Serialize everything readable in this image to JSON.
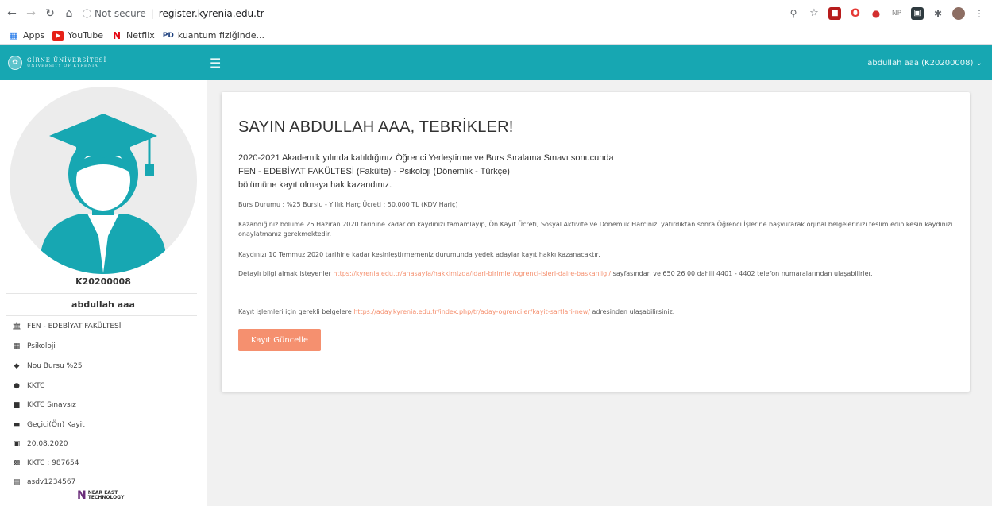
{
  "browser": {
    "security_label": "Not secure",
    "url": "register.kyrenia.edu.tr",
    "bookmarks": [
      {
        "label": "Apps",
        "icon": "apps-grid-icon"
      },
      {
        "label": "YouTube",
        "icon": "youtube-icon"
      },
      {
        "label": "Netflix",
        "icon": "netflix-icon"
      },
      {
        "label": "kuantum fiziğinde...",
        "icon": "pd-icon"
      }
    ],
    "extension_np_label": "NP"
  },
  "header": {
    "brand_line1": "GİRNE ÜNİVERSİTESİ",
    "brand_line2": "UNIVERSITY OF KYRENIA",
    "user_menu": "abdullah aaa (K20200008)",
    "accent_color": "#17a7b2"
  },
  "sidebar": {
    "student_id": "K20200008",
    "student_name": "abdullah aaa",
    "items": [
      {
        "icon": "bank-icon",
        "label": "FEN - EDEBİYAT FAKÜLTESİ"
      },
      {
        "icon": "building-icon",
        "label": "Psikoloji"
      },
      {
        "icon": "tag-icon",
        "label": "Nou Bursu %25"
      },
      {
        "icon": "map-marker-icon",
        "label": "KKTC"
      },
      {
        "icon": "user-tie-icon",
        "label": "KKTC Sınavsız"
      },
      {
        "icon": "car-icon",
        "label": "Geçici(Ön) Kayit"
      },
      {
        "icon": "calendar-icon",
        "label": "20.08.2020"
      },
      {
        "icon": "id-card-icon",
        "label": "KKTC : 987654"
      },
      {
        "icon": "passport-icon",
        "label": "asdv1234567"
      }
    ],
    "footer_logo_line1": "NEAR EAST",
    "footer_logo_line2": "TECHNOLOGY"
  },
  "main": {
    "title": "SAYIN ABDULLAH AAA, TEBRİKLER!",
    "lead_line1": "2020-2021 Akademik yılında katıldığınız Öğrenci Yerleştirme ve Burs Sıralama Sınavı sonucunda",
    "lead_line2": "FEN - EDEBİYAT FAKÜLTESİ (Fakülte) - Psikoloji (Dönemlik - Türkçe)",
    "lead_line3": "bölümüne kayıt olmaya hak kazandınız.",
    "burs_line": "Burs Durumu : %25 Burslu - Yıllık Harç Ücreti : 50.000 TL (KDV Hariç)",
    "kayit_info": "Kazandığınız bölüme 26 Haziran 2020 tarihine kadar ön kaydınızı tamamlayıp, Ön Kayıt Ücreti, Sosyal Aktivite ve Dönemlik Harcınızı yatırdıktan sonra Öğrenci İşlerine başvurarak orjinal belgelerinizi teslim edip kesin kaydınızı onaylatmanız gerekmektedir.",
    "deadline_info": "Kaydınızı 10 Temmuz 2020 tarihine kadar kesinleştirmemeniz durumunda yedek adaylar kayıt hakkı kazanacaktır.",
    "detail_pre": "Detaylı bilgi almak isteyenler ",
    "detail_link": "https://kyrenia.edu.tr/anasayfa/hakkimizda/idari-birimler/ogrenci-isleri-daire-baskanligi/",
    "detail_post": " sayfasından ve 650 26 00 dahili 4401 - 4402 telefon numaralarından ulaşabilirler.",
    "docs_pre": "Kayıt işlemleri için gerekli belgelere ",
    "docs_link": "https://aday.kyrenia.edu.tr/index.php/tr/aday-ogrenciler/kayit-sartlari-new/",
    "docs_post": " adresinden ulaşabilirsiniz.",
    "button_label": "Kayıt Güncelle",
    "link_color": "#f5906f"
  }
}
